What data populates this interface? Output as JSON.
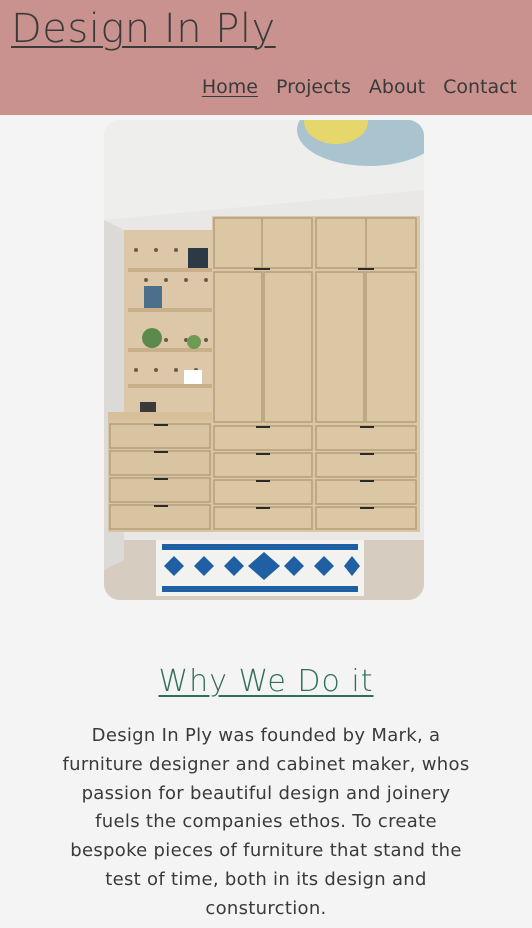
{
  "header": {
    "site_title": "Design In Ply",
    "nav": [
      {
        "label": "Home",
        "active": true
      },
      {
        "label": "Projects",
        "active": false
      },
      {
        "label": "About",
        "active": false
      },
      {
        "label": "Contact",
        "active": false
      }
    ],
    "background_color": "#c9928f"
  },
  "hero_image": {
    "description": "Birch plywood fitted wardrobe with pegboard shelving and blue patterned rug"
  },
  "section": {
    "title": "Why We Do it",
    "body": "Design In Ply was founded by Mark, a furniture designer and cabinet maker, whos passion for beautiful design and joinery fuels the companies ethos. To create bespoke pieces of furniture that stand the test of time, both in its design and consturction.",
    "title_color": "#2f6f55"
  }
}
